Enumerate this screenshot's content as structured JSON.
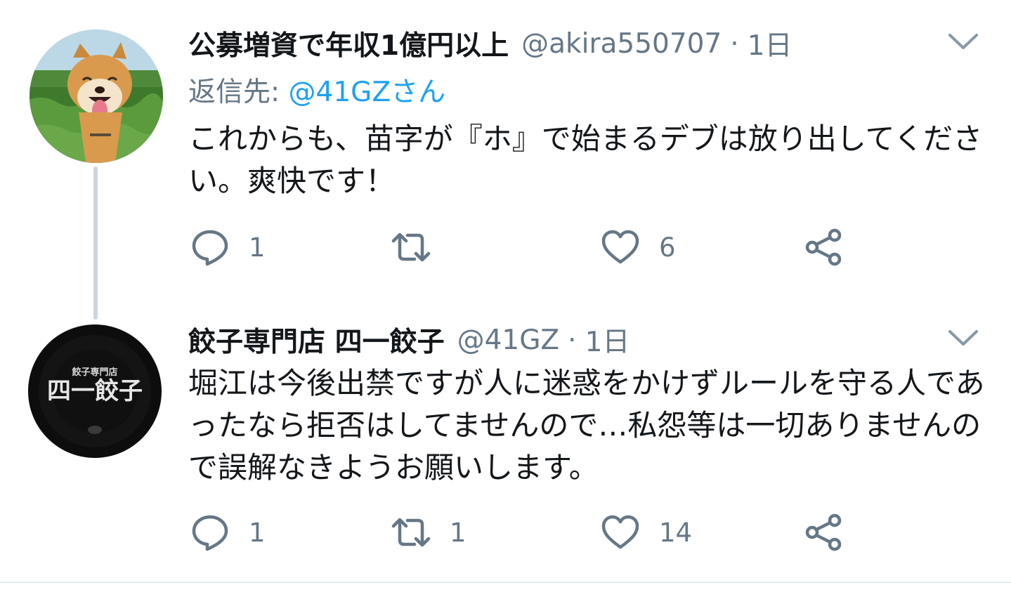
{
  "tweets": [
    {
      "display_name": "公募増資で年収1億円以上",
      "handle": "@akira550707",
      "separator": "·",
      "time": "1日",
      "reply_label": "返信先: ",
      "reply_to": "@41GZさん",
      "text": "これからも、苗字が『ホ』で始まるデブは放り出してください。爽快です！",
      "avatar_icon": "shiba-dog-avatar",
      "counts": {
        "reply": "1",
        "retweet": "",
        "like": "6"
      }
    },
    {
      "display_name": "餃子専門店 四一餃子",
      "handle": "@41GZ",
      "separator": "·",
      "time": "1日",
      "text": "堀江は今後出禁ですが人に迷惑をかけずルールを守る人であったなら拒否はしてませんので…私怨等は一切ありませんので誤解なきようお願いします。",
      "avatar_icon": "gyoza-shop-logo-avatar",
      "avatar_logo": {
        "small": "餃子専門店",
        "big": "四一餃子"
      },
      "counts": {
        "reply": "1",
        "retweet": "1",
        "like": "14"
      }
    }
  ],
  "colors": {
    "text": "#14171a",
    "secondary": "#657786",
    "link": "#1da1f2",
    "thread_line": "#ccd6dd",
    "divider": "#e6ecf0"
  },
  "icons": {
    "caret": "chevron-down-icon",
    "reply": "reply-icon",
    "retweet": "retweet-icon",
    "like": "heart-icon",
    "share": "share-icon"
  }
}
